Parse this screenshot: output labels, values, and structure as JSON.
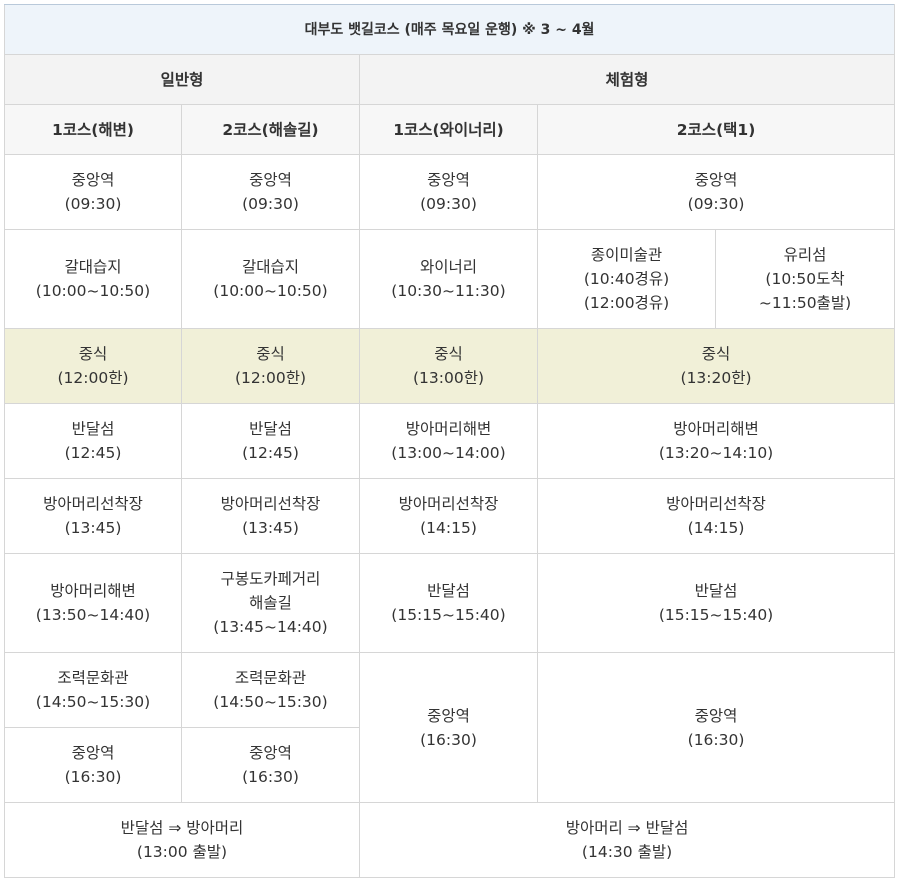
{
  "caption": "대부도 뱃길코스 (매주 목요일 운행) ※ 3 ~ 4월",
  "groups": {
    "general": "일반형",
    "experience": "체험형"
  },
  "courses": {
    "g1": "1코스(해변)",
    "g2": "2코스(해솔길)",
    "e1": "1코스(와이너리)",
    "e2": "2코스(택1)"
  },
  "rows": {
    "r1": {
      "g1": [
        "중앙역",
        "(09:30)"
      ],
      "g2": [
        "중앙역",
        "(09:30)"
      ],
      "e1": [
        "중앙역",
        "(09:30)"
      ],
      "e2": [
        "중앙역",
        "(09:30)"
      ]
    },
    "r2": {
      "g1": [
        "갈대습지",
        "(10:00~10:50)"
      ],
      "g2": [
        "갈대습지",
        "(10:00~10:50)"
      ],
      "e1": [
        "와이너리",
        "(10:30~11:30)"
      ],
      "e2a": [
        "종이미술관",
        "(10:40경유)",
        "(12:00경유)"
      ],
      "e2b": [
        "유리섬",
        "(10:50도착",
        "~11:50출발)"
      ]
    },
    "r3": {
      "g1": [
        "중식",
        "(12:00한)"
      ],
      "g2": [
        "중식",
        "(12:00한)"
      ],
      "e1": [
        "중식",
        "(13:00한)"
      ],
      "e2": [
        "중식",
        "(13:20한)"
      ]
    },
    "r4": {
      "g1": [
        "반달섬",
        "(12:45)"
      ],
      "g2": [
        "반달섬",
        "(12:45)"
      ],
      "e1": [
        "방아머리해변",
        "(13:00~14:00)"
      ],
      "e2": [
        "방아머리해변",
        "(13:20~14:10)"
      ]
    },
    "r5": {
      "g1": [
        "방아머리선착장",
        "(13:45)"
      ],
      "g2": [
        "방아머리선착장",
        "(13:45)"
      ],
      "e1": [
        "방아머리선착장",
        "(14:15)"
      ],
      "e2": [
        "방아머리선착장",
        "(14:15)"
      ]
    },
    "r6": {
      "g1": [
        "방아머리해변",
        "(13:50~14:40)"
      ],
      "g2": [
        "구봉도카페거리",
        "해솔길",
        "(13:45~14:40)"
      ],
      "e1": [
        "반달섬",
        "(15:15~15:40)"
      ],
      "e2": [
        "반달섬",
        "(15:15~15:40)"
      ]
    },
    "r7": {
      "g1": [
        "조력문화관",
        "(14:50~15:30)"
      ],
      "g2": [
        "조력문화관",
        "(14:50~15:30)"
      ],
      "e1": [
        "중앙역",
        "(16:30)"
      ],
      "e2": [
        "중앙역",
        "(16:30)"
      ]
    },
    "r8": {
      "g1": [
        "중앙역",
        "(16:30)"
      ],
      "g2": [
        "중앙역",
        "(16:30)"
      ]
    },
    "r9": {
      "general": [
        "반달섬 ⇒ 방아머리",
        "(13:00 출발)"
      ],
      "experience": [
        "방아머리 ⇒ 반달섬",
        "(14:30 출발)"
      ]
    }
  },
  "colors": {
    "lunch_bg": "#f1f0d8",
    "caption_bg": "#eef4fa",
    "header_bg": "#f3f3f3",
    "border": "#d6d6d6"
  }
}
